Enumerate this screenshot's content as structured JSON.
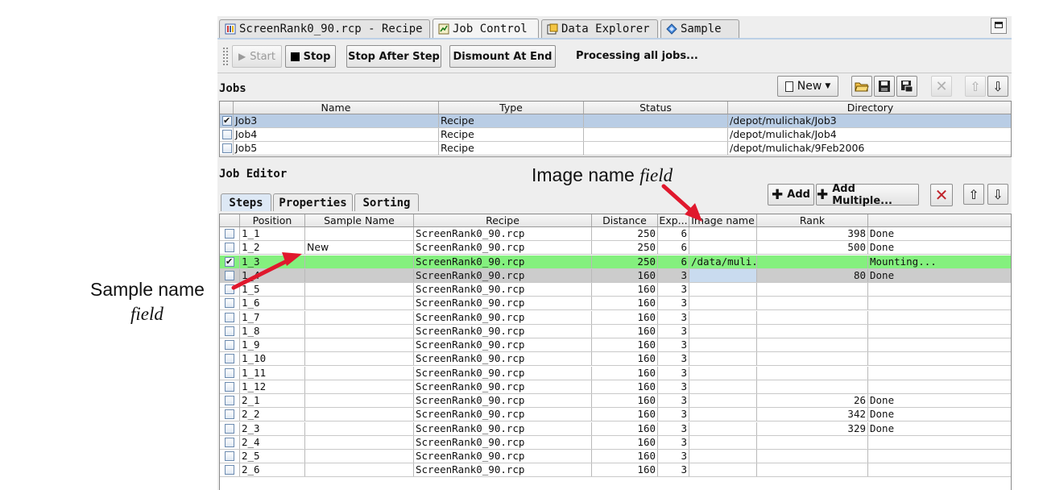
{
  "tabs": [
    {
      "label": "ScreenRank0_90.rcp - Recipe",
      "icon": "recipe-icon"
    },
    {
      "label": "Job Control",
      "icon": "job-control-icon",
      "active": true
    },
    {
      "label": "Data Explorer",
      "icon": "data-explorer-icon"
    },
    {
      "label": "Sample",
      "icon": "sample-icon"
    }
  ],
  "toolbar": {
    "start_label": "Start",
    "stop_label": "Stop",
    "stop_after_step_label": "Stop After Step",
    "dismount_label": "Dismount At End",
    "status": "Processing all jobs..."
  },
  "jobs": {
    "title": "Jobs",
    "new_label": "New",
    "columns": [
      "Name",
      "Type",
      "Status",
      "Directory"
    ],
    "rows": [
      {
        "checked": true,
        "name": "Job3",
        "type": "Recipe",
        "status": "",
        "directory": "/depot/mulichak/Job3"
      },
      {
        "checked": false,
        "name": "Job4",
        "type": "Recipe",
        "status": "",
        "directory": "/depot/mulichak/Job4"
      },
      {
        "checked": false,
        "name": "Job5",
        "type": "Recipe",
        "status": "",
        "directory": "/depot/mulichak/9Feb2006"
      }
    ]
  },
  "editor": {
    "title": "Job Editor",
    "tabs": [
      "Steps",
      "Properties",
      "Sorting"
    ],
    "add_label": "Add",
    "add_multiple_label": "Add Multiple...",
    "columns": [
      "Position",
      "Sample Name",
      "Recipe",
      "Distance",
      "Exp...",
      "Image name",
      "Rank",
      ""
    ],
    "rows": [
      {
        "checked": false,
        "position": "1_1",
        "sample": "",
        "recipe": "ScreenRank0_90.rcp",
        "distance": "250",
        "exp": "6",
        "image": "",
        "rank": "398",
        "status": "Done"
      },
      {
        "checked": false,
        "position": "1_2",
        "sample": "New",
        "recipe": "ScreenRank0_90.rcp",
        "distance": "250",
        "exp": "6",
        "image": "",
        "rank": "500",
        "status": "Done"
      },
      {
        "checked": true,
        "position": "1_3",
        "sample": "",
        "recipe": "ScreenRank0_90.rcp",
        "distance": "250",
        "exp": "6",
        "image": "/data/muli...",
        "rank": "",
        "status": "Mounting..."
      },
      {
        "checked": false,
        "position": "1_4",
        "sample": "",
        "recipe": "ScreenRank0_90.rcp",
        "distance": "160",
        "exp": "3",
        "image": "",
        "rank": "80",
        "status": "Done"
      },
      {
        "checked": false,
        "position": "1_5",
        "sample": "",
        "recipe": "ScreenRank0_90.rcp",
        "distance": "160",
        "exp": "3",
        "image": "",
        "rank": "",
        "status": ""
      },
      {
        "checked": false,
        "position": "1_6",
        "sample": "",
        "recipe": "ScreenRank0_90.rcp",
        "distance": "160",
        "exp": "3",
        "image": "",
        "rank": "",
        "status": ""
      },
      {
        "checked": false,
        "position": "1_7",
        "sample": "",
        "recipe": "ScreenRank0_90.rcp",
        "distance": "160",
        "exp": "3",
        "image": "",
        "rank": "",
        "status": ""
      },
      {
        "checked": false,
        "position": "1_8",
        "sample": "",
        "recipe": "ScreenRank0_90.rcp",
        "distance": "160",
        "exp": "3",
        "image": "",
        "rank": "",
        "status": ""
      },
      {
        "checked": false,
        "position": "1_9",
        "sample": "",
        "recipe": "ScreenRank0_90.rcp",
        "distance": "160",
        "exp": "3",
        "image": "",
        "rank": "",
        "status": ""
      },
      {
        "checked": false,
        "position": "1_10",
        "sample": "",
        "recipe": "ScreenRank0_90.rcp",
        "distance": "160",
        "exp": "3",
        "image": "",
        "rank": "",
        "status": ""
      },
      {
        "checked": false,
        "position": "1_11",
        "sample": "",
        "recipe": "ScreenRank0_90.rcp",
        "distance": "160",
        "exp": "3",
        "image": "",
        "rank": "",
        "status": ""
      },
      {
        "checked": false,
        "position": "1_12",
        "sample": "",
        "recipe": "ScreenRank0_90.rcp",
        "distance": "160",
        "exp": "3",
        "image": "",
        "rank": "",
        "status": ""
      },
      {
        "checked": false,
        "position": "2_1",
        "sample": "",
        "recipe": "ScreenRank0_90.rcp",
        "distance": "160",
        "exp": "3",
        "image": "",
        "rank": "26",
        "status": "Done"
      },
      {
        "checked": false,
        "position": "2_2",
        "sample": "",
        "recipe": "ScreenRank0_90.rcp",
        "distance": "160",
        "exp": "3",
        "image": "",
        "rank": "342",
        "status": "Done"
      },
      {
        "checked": false,
        "position": "2_3",
        "sample": "",
        "recipe": "ScreenRank0_90.rcp",
        "distance": "160",
        "exp": "3",
        "image": "",
        "rank": "329",
        "status": "Done"
      },
      {
        "checked": false,
        "position": "2_4",
        "sample": "",
        "recipe": "ScreenRank0_90.rcp",
        "distance": "160",
        "exp": "3",
        "image": "",
        "rank": "",
        "status": ""
      },
      {
        "checked": false,
        "position": "2_5",
        "sample": "",
        "recipe": "ScreenRank0_90.rcp",
        "distance": "160",
        "exp": "3",
        "image": "",
        "rank": "",
        "status": ""
      },
      {
        "checked": false,
        "position": "2_6",
        "sample": "",
        "recipe": "ScreenRank0_90.rcp",
        "distance": "160",
        "exp": "3",
        "image": "",
        "rank": "",
        "status": ""
      }
    ]
  },
  "annotations": {
    "image_name_label": "Image name",
    "image_name_italic": "field",
    "sample_name_label": "Sample name",
    "sample_name_italic": "field"
  },
  "colors": {
    "selected_row": "#b9cde5",
    "running_row": "#84f07e",
    "disabled_row": "#cccccc",
    "arrow": "#e0182d"
  }
}
